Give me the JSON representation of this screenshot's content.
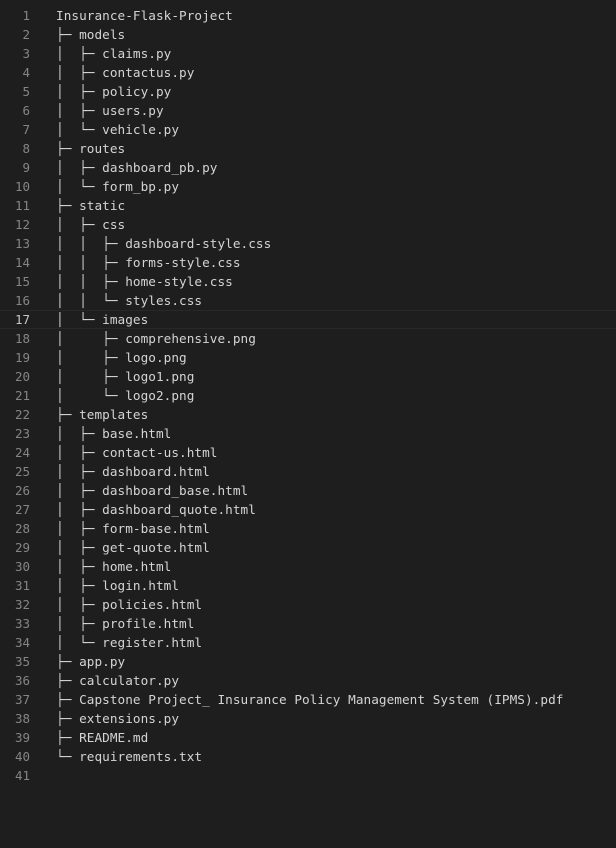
{
  "editor": {
    "current_line": 17,
    "lines": [
      {
        "n": "1",
        "text": "Insurance-Flask-Project"
      },
      {
        "n": "2",
        "text": "├─ models"
      },
      {
        "n": "3",
        "text": "│  ├─ claims.py"
      },
      {
        "n": "4",
        "text": "│  ├─ contactus.py"
      },
      {
        "n": "5",
        "text": "│  ├─ policy.py"
      },
      {
        "n": "6",
        "text": "│  ├─ users.py"
      },
      {
        "n": "7",
        "text": "│  └─ vehicle.py"
      },
      {
        "n": "8",
        "text": "├─ routes"
      },
      {
        "n": "9",
        "text": "│  ├─ dashboard_pb.py"
      },
      {
        "n": "10",
        "text": "│  └─ form_bp.py"
      },
      {
        "n": "11",
        "text": "├─ static"
      },
      {
        "n": "12",
        "text": "│  ├─ css"
      },
      {
        "n": "13",
        "text": "│  │  ├─ dashboard-style.css"
      },
      {
        "n": "14",
        "text": "│  │  ├─ forms-style.css"
      },
      {
        "n": "15",
        "text": "│  │  ├─ home-style.css"
      },
      {
        "n": "16",
        "text": "│  │  └─ styles.css"
      },
      {
        "n": "17",
        "text": "│  └─ images"
      },
      {
        "n": "18",
        "text": "│     ├─ comprehensive.png"
      },
      {
        "n": "19",
        "text": "│     ├─ logo.png"
      },
      {
        "n": "20",
        "text": "│     ├─ logo1.png"
      },
      {
        "n": "21",
        "text": "│     └─ logo2.png"
      },
      {
        "n": "22",
        "text": "├─ templates"
      },
      {
        "n": "23",
        "text": "│  ├─ base.html"
      },
      {
        "n": "24",
        "text": "│  ├─ contact-us.html"
      },
      {
        "n": "25",
        "text": "│  ├─ dashboard.html"
      },
      {
        "n": "26",
        "text": "│  ├─ dashboard_base.html"
      },
      {
        "n": "27",
        "text": "│  ├─ dashboard_quote.html"
      },
      {
        "n": "28",
        "text": "│  ├─ form-base.html"
      },
      {
        "n": "29",
        "text": "│  ├─ get-quote.html"
      },
      {
        "n": "30",
        "text": "│  ├─ home.html"
      },
      {
        "n": "31",
        "text": "│  ├─ login.html"
      },
      {
        "n": "32",
        "text": "│  ├─ policies.html"
      },
      {
        "n": "33",
        "text": "│  ├─ profile.html"
      },
      {
        "n": "34",
        "text": "│  └─ register.html"
      },
      {
        "n": "35",
        "text": "├─ app.py"
      },
      {
        "n": "36",
        "text": "├─ calculator.py"
      },
      {
        "n": "37",
        "text": "├─ Capstone Project_ Insurance Policy Management System (IPMS).pdf"
      },
      {
        "n": "38",
        "text": "├─ extensions.py"
      },
      {
        "n": "39",
        "text": "├─ README.md"
      },
      {
        "n": "40",
        "text": "└─ requirements.txt"
      },
      {
        "n": "41",
        "text": ""
      }
    ]
  }
}
